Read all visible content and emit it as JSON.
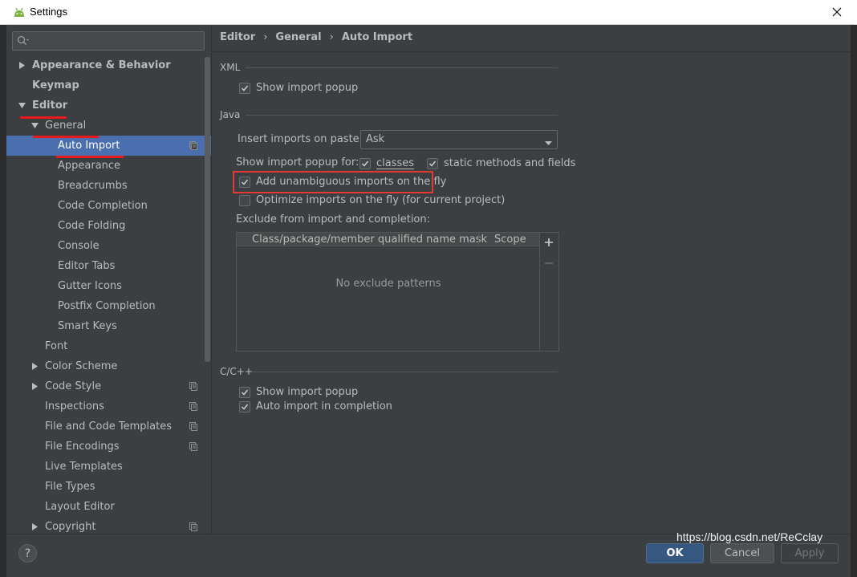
{
  "window": {
    "title": "Settings"
  },
  "search": {
    "placeholder": ""
  },
  "tree": [
    {
      "label": "Appearance & Behavior",
      "bold": true,
      "arrow": "right"
    },
    {
      "label": "Keymap",
      "bold": true,
      "arrow": ""
    },
    {
      "label": "Editor",
      "bold": true,
      "arrow": "down"
    },
    {
      "label": "General",
      "bold": false,
      "arrow": "down"
    },
    {
      "label": "Auto Import",
      "bold": false,
      "arrow": "",
      "selected": true,
      "copy": true
    },
    {
      "label": "Appearance",
      "bold": false,
      "arrow": ""
    },
    {
      "label": "Breadcrumbs",
      "bold": false,
      "arrow": ""
    },
    {
      "label": "Code Completion",
      "bold": false,
      "arrow": ""
    },
    {
      "label": "Code Folding",
      "bold": false,
      "arrow": ""
    },
    {
      "label": "Console",
      "bold": false,
      "arrow": ""
    },
    {
      "label": "Editor Tabs",
      "bold": false,
      "arrow": ""
    },
    {
      "label": "Gutter Icons",
      "bold": false,
      "arrow": ""
    },
    {
      "label": "Postfix Completion",
      "bold": false,
      "arrow": ""
    },
    {
      "label": "Smart Keys",
      "bold": false,
      "arrow": ""
    },
    {
      "label": "Font",
      "bold": false,
      "arrow": ""
    },
    {
      "label": "Color Scheme",
      "bold": false,
      "arrow": "right"
    },
    {
      "label": "Code Style",
      "bold": false,
      "arrow": "right",
      "copy": true
    },
    {
      "label": "Inspections",
      "bold": false,
      "arrow": "",
      "copy": true
    },
    {
      "label": "File and Code Templates",
      "bold": false,
      "arrow": "",
      "copy": true
    },
    {
      "label": "File Encodings",
      "bold": false,
      "arrow": "",
      "copy": true
    },
    {
      "label": "Live Templates",
      "bold": false,
      "arrow": ""
    },
    {
      "label": "File Types",
      "bold": false,
      "arrow": ""
    },
    {
      "label": "Layout Editor",
      "bold": false,
      "arrow": ""
    },
    {
      "label": "Copyright",
      "bold": false,
      "arrow": "right",
      "copy": true
    }
  ],
  "breadcrumb": {
    "part1": "Editor",
    "sep": "›",
    "part2": "General",
    "part3": "Auto Import"
  },
  "xml": {
    "title": "XML",
    "show_import_popup": {
      "label": "Show import popup",
      "checked": true
    }
  },
  "java": {
    "title": "Java",
    "insert_label": "Insert imports on paste:",
    "insert_value": "Ask",
    "popup_for_label": "Show import popup for:",
    "classes": {
      "label": "classes",
      "checked": true
    },
    "static": {
      "label": "static methods and fields",
      "checked": true
    },
    "add_unambiguous": {
      "label": "Add unambiguous imports on the fly",
      "checked": true
    },
    "optimize": {
      "label": "Optimize imports on the fly (for current project)",
      "checked": false
    },
    "exclude_label": "Exclude from import and completion:",
    "table": {
      "col1": "Class/package/member qualified name mask",
      "col2": "Scope",
      "empty": "No exclude patterns",
      "add": "+",
      "remove": "−"
    }
  },
  "cpp": {
    "title": "C/C++",
    "show_import_popup": {
      "label": "Show import popup",
      "checked": true
    },
    "auto_import": {
      "label": "Auto import in completion",
      "checked": true
    }
  },
  "buttons": {
    "help": "?",
    "ok": "OK",
    "cancel": "Cancel",
    "apply": "Apply"
  },
  "watermark": "https://blog.csdn.net/ReCclay",
  "colors": {
    "selection": "#4b6eaf",
    "annotation": "#e53935",
    "ok": "#365880"
  }
}
